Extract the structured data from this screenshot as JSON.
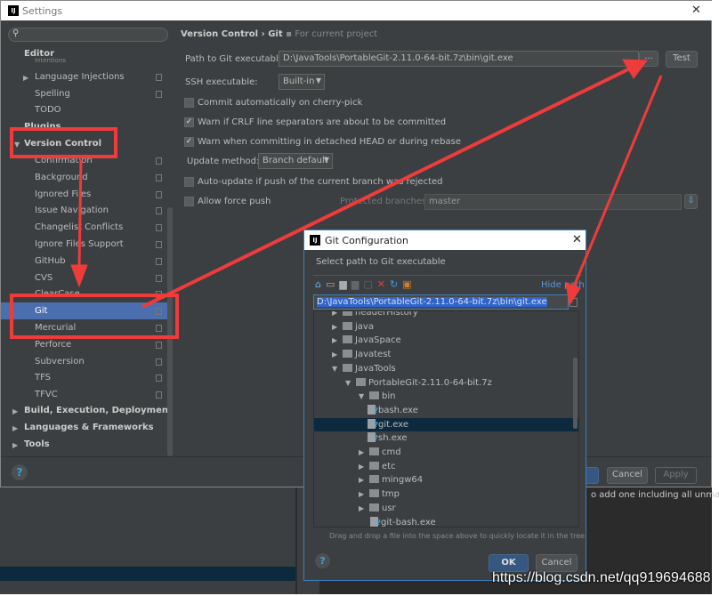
{
  "settings": {
    "title": "Settings",
    "sidebar": {
      "editor": "Editor",
      "intentions": "Intentions",
      "language_injections": "Language Injections",
      "spelling": "Spelling",
      "todo": "TODO",
      "plugins": "Plugins",
      "version_control": "Version Control",
      "vc_children": [
        "Confirmation",
        "Background",
        "Ignored Files",
        "Issue Navigation",
        "Changelist Conflicts",
        "Ignore Files Support",
        "GitHub",
        "CVS",
        "ClearCase",
        "Git",
        "Mercurial",
        "Perforce",
        "Subversion",
        "TFS",
        "TFVC"
      ],
      "selected": "Git",
      "bottom": [
        "Build, Execution, Deployment",
        "Languages & Frameworks",
        "Tools"
      ]
    },
    "breadcrumb": {
      "parent": "Version Control",
      "sep": "›",
      "current": "Git",
      "scope": "For current project"
    },
    "path_label": "Path to Git executable:",
    "path_value": "D:\\JavaTools\\PortableGit-2.11.0-64-bit.7z\\bin\\git.exe",
    "browse": "...",
    "test": "Test",
    "ssh_label": "SSH executable:",
    "ssh_value": "Built-in",
    "checkboxes": [
      {
        "label": "Commit automatically on cherry-pick",
        "checked": false
      },
      {
        "label": "Warn if CRLF line separators are about to be committed",
        "checked": true
      },
      {
        "label": "Warn when committing in detached HEAD or during rebase",
        "checked": true
      }
    ],
    "update_label": "Update method:",
    "update_value": "Branch default",
    "auto_update": {
      "label": "Auto-update if push of the current branch was rejected",
      "checked": false
    },
    "force_push": {
      "label": "Allow force push",
      "checked": false
    },
    "protected_label": "Protected branches:",
    "protected_value": "master",
    "help": "?",
    "cancel": "Cancel",
    "apply": "Apply",
    "behind_text": "o add one including all unmapped"
  },
  "git_dialog": {
    "title": "Git Configuration",
    "subtitle": "Select path to Git executable",
    "hide_path": "Hide path",
    "path": "D:\\JavaTools\\PortableGit-2.11.0-64-bit.7z\\bin\\git.exe",
    "tree": [
      {
        "name": "headerHistory",
        "level": 0,
        "type": "folder",
        "expanded": false
      },
      {
        "name": "java",
        "level": 0,
        "type": "folder",
        "expanded": false
      },
      {
        "name": "JavaSpace",
        "level": 0,
        "type": "folder",
        "expanded": false
      },
      {
        "name": "Javatest",
        "level": 0,
        "type": "folder",
        "expanded": false
      },
      {
        "name": "JavaTools",
        "level": 0,
        "type": "folder",
        "expanded": true
      },
      {
        "name": "PortableGit-2.11.0-64-bit.7z",
        "level": 1,
        "type": "folder",
        "expanded": true
      },
      {
        "name": "bin",
        "level": 2,
        "type": "folder",
        "expanded": true
      },
      {
        "name": "bash.exe",
        "level": 3,
        "type": "file"
      },
      {
        "name": "git.exe",
        "level": 3,
        "type": "file",
        "selected": true
      },
      {
        "name": "sh.exe",
        "level": 3,
        "type": "file"
      },
      {
        "name": "cmd",
        "level": 2,
        "type": "folder",
        "expanded": false
      },
      {
        "name": "etc",
        "level": 2,
        "type": "folder",
        "expanded": false
      },
      {
        "name": "mingw64",
        "level": 2,
        "type": "folder",
        "expanded": false
      },
      {
        "name": "tmp",
        "level": 2,
        "type": "folder",
        "expanded": false
      },
      {
        "name": "usr",
        "level": 2,
        "type": "folder",
        "expanded": false
      },
      {
        "name": "git-bash.exe",
        "level": 2,
        "type": "file"
      }
    ],
    "hint": "Drag and drop a file into the space above to quickly locate it in the tree",
    "help": "?",
    "ok": "OK",
    "cancel": "Cancel"
  },
  "watermark": "https://blog.csdn.net/qq919694688",
  "colors": {
    "annotation": "#f03b3b",
    "selection": "#4b6eaf",
    "accent": "#3d7fc1"
  }
}
